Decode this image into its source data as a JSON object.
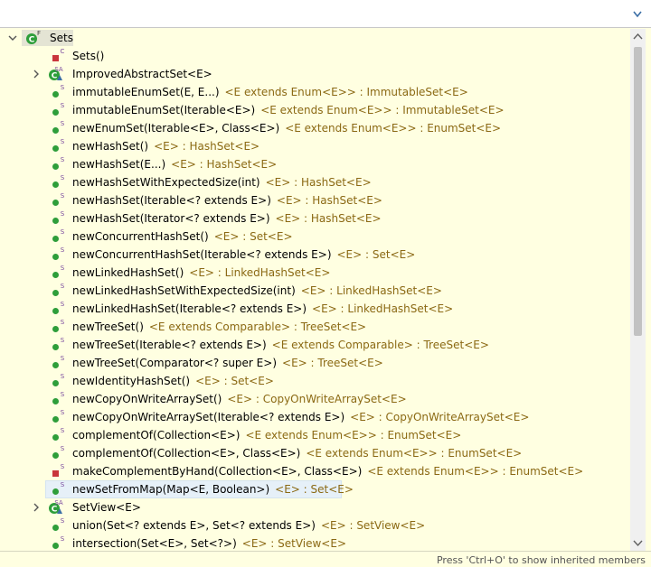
{
  "filter": {
    "value": "",
    "placeholder": ""
  },
  "status": {
    "hint": "Press 'Ctrl+O' to show inherited members"
  },
  "colors": {
    "public": "#2e9e3a",
    "private": "#c9353c",
    "return_type": "#8b6914",
    "selected_bg": "#e6f0f8"
  },
  "tree": {
    "root": {
      "label": "Sets",
      "overlay": "F",
      "icon": "class-icon"
    },
    "items": [
      {
        "kind": "constructor",
        "vis": "private",
        "overlay": "C",
        "sig": "Sets()",
        "ret": ""
      },
      {
        "kind": "class",
        "vis": "public",
        "overlay": "SA",
        "sig": "ImprovedAbstractSet<E>",
        "ret": "",
        "expandable": true
      },
      {
        "kind": "method",
        "vis": "public",
        "overlay": "S",
        "sig": "immutableEnumSet(E, E...)",
        "ret": "<E extends Enum<E>> : ImmutableSet<E>"
      },
      {
        "kind": "method",
        "vis": "public",
        "overlay": "S",
        "sig": "immutableEnumSet(Iterable<E>)",
        "ret": "<E extends Enum<E>> : ImmutableSet<E>"
      },
      {
        "kind": "method",
        "vis": "public",
        "overlay": "S",
        "sig": "newEnumSet(Iterable<E>, Class<E>)",
        "ret": "<E extends Enum<E>> : EnumSet<E>"
      },
      {
        "kind": "method",
        "vis": "public",
        "overlay": "S",
        "sig": "newHashSet()",
        "ret": "<E> : HashSet<E>"
      },
      {
        "kind": "method",
        "vis": "public",
        "overlay": "S",
        "sig": "newHashSet(E...)",
        "ret": "<E> : HashSet<E>"
      },
      {
        "kind": "method",
        "vis": "public",
        "overlay": "S",
        "sig": "newHashSetWithExpectedSize(int)",
        "ret": "<E> : HashSet<E>"
      },
      {
        "kind": "method",
        "vis": "public",
        "overlay": "S",
        "sig": "newHashSet(Iterable<? extends E>)",
        "ret": "<E> : HashSet<E>"
      },
      {
        "kind": "method",
        "vis": "public",
        "overlay": "S",
        "sig": "newHashSet(Iterator<? extends E>)",
        "ret": "<E> : HashSet<E>"
      },
      {
        "kind": "method",
        "vis": "public",
        "overlay": "S",
        "sig": "newConcurrentHashSet()",
        "ret": "<E> : Set<E>"
      },
      {
        "kind": "method",
        "vis": "public",
        "overlay": "S",
        "sig": "newConcurrentHashSet(Iterable<? extends E>)",
        "ret": "<E> : Set<E>"
      },
      {
        "kind": "method",
        "vis": "public",
        "overlay": "S",
        "sig": "newLinkedHashSet()",
        "ret": "<E> : LinkedHashSet<E>"
      },
      {
        "kind": "method",
        "vis": "public",
        "overlay": "S",
        "sig": "newLinkedHashSetWithExpectedSize(int)",
        "ret": "<E> : LinkedHashSet<E>"
      },
      {
        "kind": "method",
        "vis": "public",
        "overlay": "S",
        "sig": "newLinkedHashSet(Iterable<? extends E>)",
        "ret": "<E> : LinkedHashSet<E>"
      },
      {
        "kind": "method",
        "vis": "public",
        "overlay": "S",
        "sig": "newTreeSet()",
        "ret": "<E extends Comparable> : TreeSet<E>"
      },
      {
        "kind": "method",
        "vis": "public",
        "overlay": "S",
        "sig": "newTreeSet(Iterable<? extends E>)",
        "ret": "<E extends Comparable> : TreeSet<E>"
      },
      {
        "kind": "method",
        "vis": "public",
        "overlay": "S",
        "sig": "newTreeSet(Comparator<? super E>)",
        "ret": "<E> : TreeSet<E>"
      },
      {
        "kind": "method",
        "vis": "public",
        "overlay": "S",
        "sig": "newIdentityHashSet()",
        "ret": "<E> : Set<E>"
      },
      {
        "kind": "method",
        "vis": "public",
        "overlay": "S",
        "sig": "newCopyOnWriteArraySet()",
        "ret": "<E> : CopyOnWriteArraySet<E>"
      },
      {
        "kind": "method",
        "vis": "public",
        "overlay": "S",
        "sig": "newCopyOnWriteArraySet(Iterable<? extends E>)",
        "ret": "<E> : CopyOnWriteArraySet<E>"
      },
      {
        "kind": "method",
        "vis": "public",
        "overlay": "S",
        "sig": "complementOf(Collection<E>)",
        "ret": "<E extends Enum<E>> : EnumSet<E>"
      },
      {
        "kind": "method",
        "vis": "public",
        "overlay": "S",
        "sig": "complementOf(Collection<E>, Class<E>)",
        "ret": "<E extends Enum<E>> : EnumSet<E>"
      },
      {
        "kind": "method",
        "vis": "private",
        "overlay": "S",
        "sig": "makeComplementByHand(Collection<E>, Class<E>)",
        "ret": "<E extends Enum<E>> : EnumSet<E>"
      },
      {
        "kind": "method",
        "vis": "public",
        "overlay": "S",
        "sig": "newSetFromMap(Map<E, Boolean>)",
        "ret": "<E> : Set<E>",
        "selected": true
      },
      {
        "kind": "class",
        "vis": "public",
        "overlay": "SA",
        "sig": "SetView<E>",
        "ret": "",
        "expandable": true
      },
      {
        "kind": "method",
        "vis": "public",
        "overlay": "S",
        "sig": "union(Set<? extends E>, Set<? extends E>)",
        "ret": "<E> : SetView<E>"
      },
      {
        "kind": "method",
        "vis": "public",
        "overlay": "S",
        "sig": "intersection(Set<E>, Set<?>)",
        "ret": "<E> : SetView<E>"
      }
    ]
  }
}
